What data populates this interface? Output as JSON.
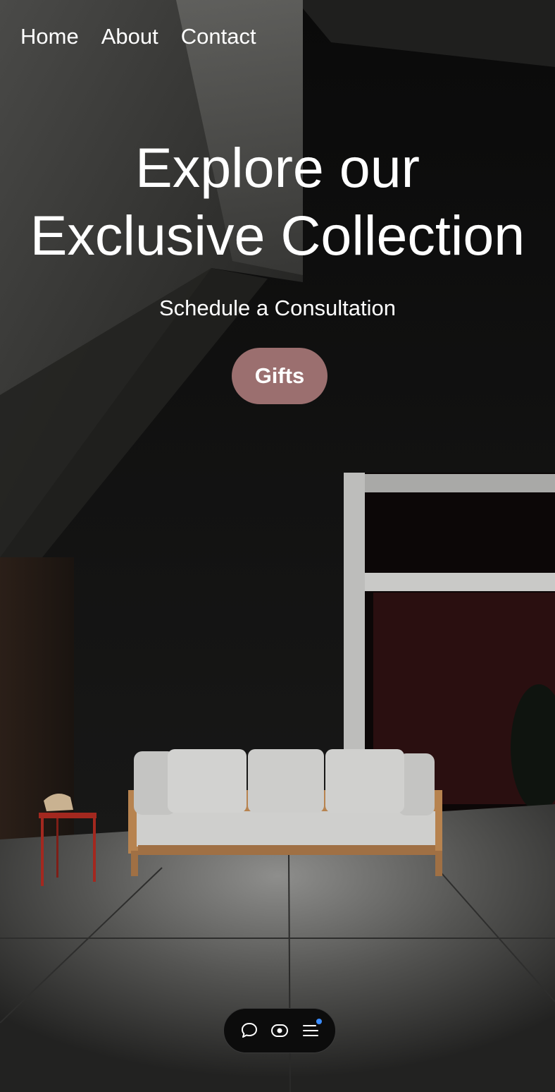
{
  "nav": {
    "items": [
      {
        "label": "Home"
      },
      {
        "label": "About"
      },
      {
        "label": "Contact"
      }
    ]
  },
  "hero": {
    "headline_line1": "Explore our",
    "headline_line2": "Exclusive Collection",
    "subtitle": "Schedule a Consultation",
    "cta_label": "Gifts"
  },
  "toolbar": {
    "icons": [
      "chat-bubble-icon",
      "eye-icon",
      "menu-icon"
    ]
  },
  "colors": {
    "cta_background": "#9b6f6f",
    "text": "#ffffff",
    "toolbar_background": "#0c0c0c",
    "notification_dot": "#3b8cff"
  }
}
